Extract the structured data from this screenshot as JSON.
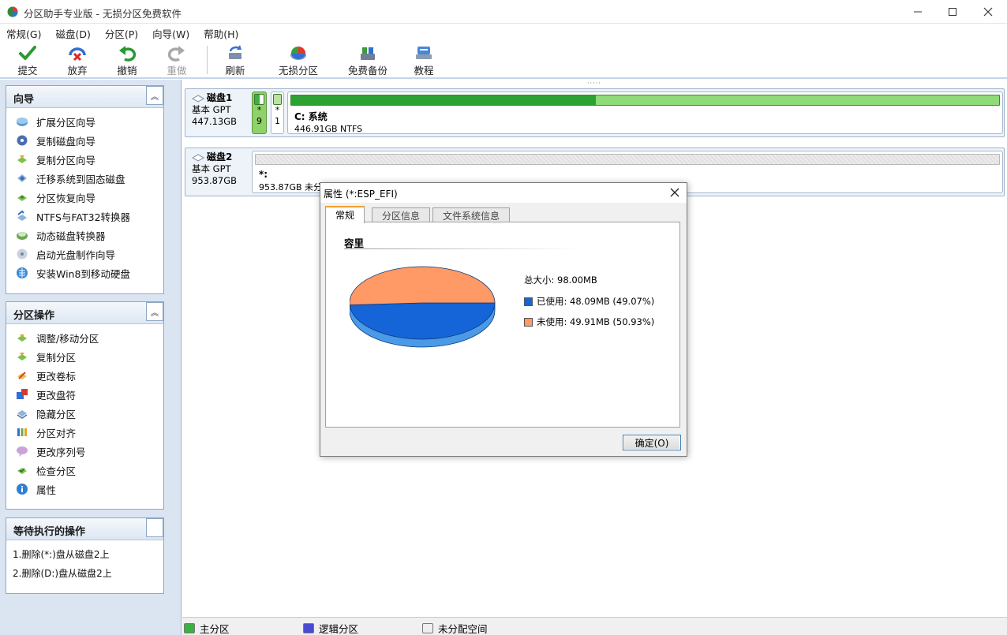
{
  "window": {
    "title": "分区助手专业版 - 无损分区免费软件"
  },
  "menu": [
    {
      "label": "常规(G)"
    },
    {
      "label": "磁盘(D)"
    },
    {
      "label": "分区(P)"
    },
    {
      "label": "向导(W)"
    },
    {
      "label": "帮助(H)"
    }
  ],
  "toolbar": {
    "commit": "提交",
    "discard": "放弃",
    "undo": "撤销",
    "redo": "重做",
    "refresh": "刷新",
    "lossless_partition": "无损分区",
    "free_backup": "免费备份",
    "tutorial": "教程"
  },
  "wizard_panel": {
    "title": "向导",
    "items": [
      {
        "label": "扩展分区向导"
      },
      {
        "label": "复制磁盘向导"
      },
      {
        "label": "复制分区向导"
      },
      {
        "label": "迁移系统到固态磁盘"
      },
      {
        "label": "分区恢复向导"
      },
      {
        "label": "NTFS与FAT32转换器"
      },
      {
        "label": "动态磁盘转换器"
      },
      {
        "label": "启动光盘制作向导"
      },
      {
        "label": "安装Win8到移动硬盘"
      }
    ]
  },
  "partition_panel": {
    "title": "分区操作",
    "items": [
      {
        "label": "调整/移动分区"
      },
      {
        "label": "复制分区"
      },
      {
        "label": "更改卷标"
      },
      {
        "label": "更改盘符"
      },
      {
        "label": "隐藏分区"
      },
      {
        "label": "分区对齐"
      },
      {
        "label": "更改序列号"
      },
      {
        "label": "检查分区"
      },
      {
        "label": "属性"
      }
    ]
  },
  "pending_panel": {
    "title": "等待执行的操作",
    "items": [
      {
        "label": "1.删除(*:)盘从磁盘2上"
      },
      {
        "label": "2.删除(D:)盘从磁盘2上"
      }
    ]
  },
  "disks": [
    {
      "name": "磁盘1",
      "type": "基本 GPT",
      "size": "447.13GB",
      "small_parts": [
        {
          "line1": "*",
          "line2": "9"
        },
        {
          "line1": "*",
          "line2": "1"
        }
      ],
      "main_part": {
        "label": "C: 系统",
        "detail": "446.91GB NTFS",
        "used_fraction": 0.43
      }
    },
    {
      "name": "磁盘2",
      "type": "基本 GPT",
      "size": "953.87GB",
      "main_part": {
        "label": "*:",
        "detail": "953.87GB 未分配空间",
        "used_fraction": 0
      }
    }
  ],
  "statusbar": {
    "primary": "主分区",
    "logical": "逻辑分区",
    "unallocated": "未分配空间"
  },
  "dialog": {
    "title": "属性 (*:ESP_EFI)",
    "tabs": [
      {
        "label": "常规"
      },
      {
        "label": "分区信息"
      },
      {
        "label": "文件系统信息"
      }
    ],
    "section_title": "容里",
    "total": "总大小: 98.00MB",
    "used": "已使用: 48.09MB (49.07%)",
    "free": "未使用: 49.91MB (50.93%)",
    "used_fraction": 0.4907,
    "ok": "确定(O)"
  },
  "colors": {
    "used": "#1565d8",
    "free": "#ff9966",
    "primary_partition": "#3cb043",
    "logical_partition": "#4a4ad0",
    "accent": "#3c7fb1"
  }
}
